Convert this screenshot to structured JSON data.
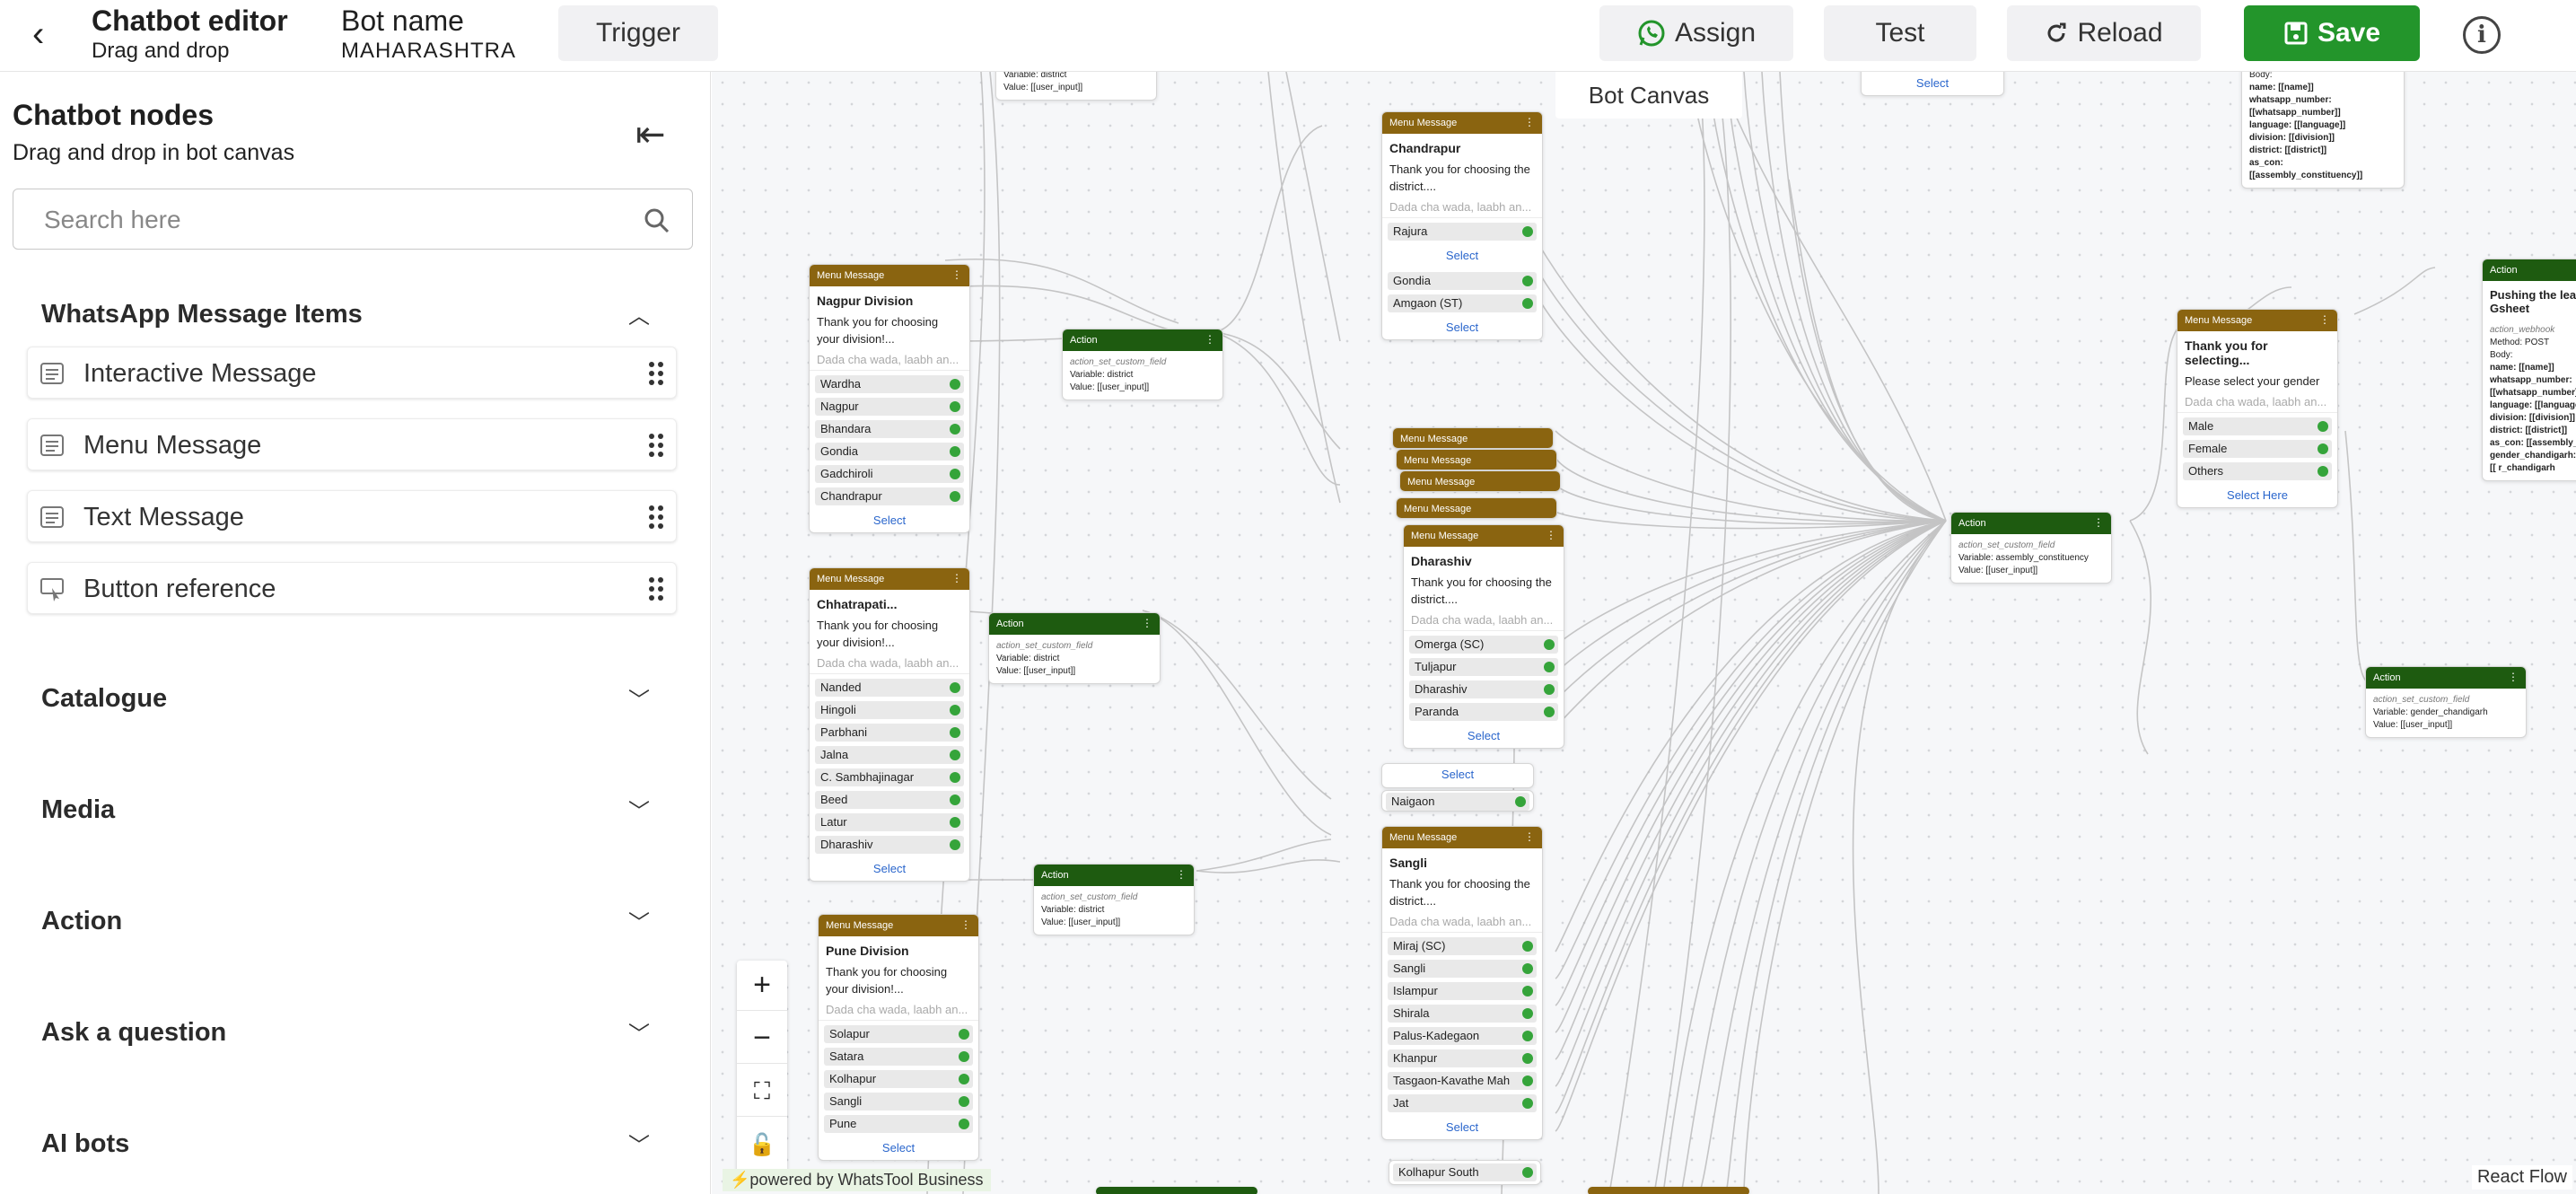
{
  "header": {
    "title": "Chatbot editor",
    "subtitle": "Drag and drop",
    "bot_name_label": "Bot name",
    "bot_name": "MAHARASHTRA",
    "trigger_label": "Trigger",
    "assign_label": "Assign",
    "test_label": "Test",
    "reload_label": "Reload",
    "save_label": "Save",
    "info_label": "i"
  },
  "sidebar": {
    "title": "Chatbot nodes",
    "subtitle": "Drag and drop in bot canvas",
    "search_placeholder": "Search here",
    "whatsapp_section": "WhatsApp Message Items",
    "items": [
      {
        "label": "Interactive Message"
      },
      {
        "label": "Menu Message"
      },
      {
        "label": "Text Message"
      },
      {
        "label": "Button reference"
      }
    ],
    "sections": [
      "Catalogue",
      "Media",
      "Action",
      "Ask a question",
      "AI bots"
    ]
  },
  "canvas": {
    "label": "Bot Canvas",
    "powered": "powered by WhatsTool Business",
    "react_flow": "React Flow",
    "menu_header": "Menu Message",
    "action_header": "Action",
    "placeholder": "Dada cha wada, laabh an...",
    "select": "Select",
    "select_here": "Select Here",
    "nagpur": {
      "title": "Nagpur Division",
      "msg": "Thank you for choosing your division!...",
      "opts": [
        "Wardha",
        "Nagpur",
        "Bhandara",
        "Gondia",
        "Gadchiroli",
        "Chandrapur"
      ]
    },
    "chhatrapati": {
      "title": "Chhatrapati...",
      "msg": "Thank you for choosing your division!...",
      "opts": [
        "Nanded",
        "Hingoli",
        "Parbhani",
        "Jalna",
        "C. Sambhajinagar",
        "Beed",
        "Latur",
        "Dharashiv"
      ]
    },
    "pune": {
      "title": "Pune Division",
      "msg": "Thank you for choosing your division!...",
      "opts": [
        "Solapur",
        "Satara",
        "Kolhapur",
        "Sangli",
        "Pune"
      ]
    },
    "chandrapur": {
      "title": "Chandrapur",
      "msg": "Thank you for choosing the district....",
      "opts": [
        "Rajura",
        "Gondia",
        "Amgaon (ST)"
      ]
    },
    "dharashiv": {
      "title": "Dharashiv",
      "msg": "Thank you for choosing the district....",
      "opts": [
        "Omerga (SC)",
        "Tuljapur",
        "Dharashiv",
        "Paranda"
      ]
    },
    "sangli": {
      "title": "Sangli",
      "msg": "Thank you for choosing the district....",
      "opts": [
        "Miraj (SC)",
        "Sangli",
        "Islampur",
        "Shirala",
        "Palus-Kadegaon",
        "Khanpur",
        "Tasgaon-Kavathe Mah",
        "Jat"
      ]
    },
    "gender": {
      "title": "Thank you for selecting...",
      "msg": "Please select your gender",
      "opts": [
        "Male",
        "Female",
        "Others"
      ]
    },
    "action_district": {
      "type": "action_set_custom_field",
      "var": "Variable: district",
      "val": "Value: [[user_input]]"
    },
    "action_assembly": {
      "type": "action_set_custom_field",
      "var": "Variable: assembly_constituency",
      "val": "Value: [[user_input]]"
    },
    "action_gender": {
      "type": "action_set_custom_field",
      "var": "Variable: gender_chandigarh",
      "val": "Value: [[user_input]]"
    },
    "gsheet": {
      "title": "Pushing the lea Gsheet",
      "l1": "action_webhook",
      "l2": "Method: POST",
      "l3": "Body:",
      "l4": "name: [[name]]",
      "l5": "whatsapp_number: [[whatsapp_number]]",
      "l6": "language: [[language]]",
      "l7": "division: [[division]]",
      "l8": "district: [[district]]",
      "l9": "as_con: [[assembly_c",
      "l10": "gender_chandigarh:",
      "l11": "[[ r_chandigarh"
    },
    "top_webhook": {
      "l1": "Body:",
      "l2": "name: [[name]]",
      "l3": "whatsapp_number: [[whatsapp_number]]",
      "l4": "language: [[language]]",
      "l5": "division: [[division]]",
      "l6": "district: [[district]]",
      "l7": "as_con: [[assembly_constituency]]"
    },
    "naigaon": "Naigaon",
    "kolhapur_south": "Kolhapur South"
  }
}
